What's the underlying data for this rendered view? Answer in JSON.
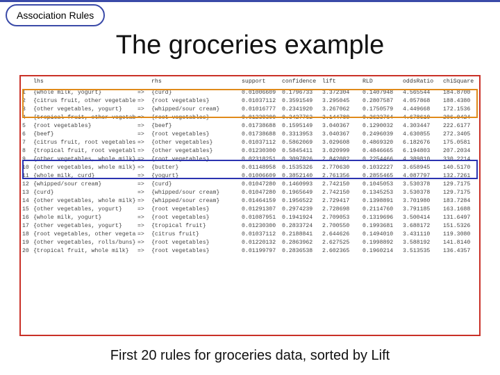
{
  "badge_label": "Association Rules",
  "title": "The groceries example",
  "caption": "First 20 rules for groceries data, sorted by Lift",
  "headers": [
    "",
    "lhs",
    "",
    "rhs",
    "support",
    "confidence",
    "lift",
    "RLD",
    "oddsRatio",
    "chiSquare"
  ],
  "rows": [
    {
      "idx": "1",
      "lhs": "{whole milk,\n yogurt}",
      "rhs": "{curd}",
      "support": "0.01006609",
      "confidence": "0.1796733",
      "lift": "3.372304",
      "rld": "0.1407948",
      "oddsRatio": "4.565544",
      "chiSquare": "184.8700"
    },
    {
      "idx": "2",
      "lhs": "{citrus fruit,\n other vegetables}",
      "rhs": "{root vegetables}",
      "support": "0.01037112",
      "confidence": "0.3591549",
      "lift": "3.295045",
      "rld": "0.2807587",
      "oddsRatio": "4.057868",
      "chiSquare": "188.4380"
    },
    {
      "idx": "3",
      "lhs": "{other vegetables,\n yogurt}",
      "rhs": "{whipped/sour cream}",
      "support": "0.01016777",
      "confidence": "0.2341920",
      "lift": "3.267062",
      "rld": "0.1750579",
      "oddsRatio": "4.449668",
      "chiSquare": "172.1536"
    },
    {
      "idx": "4",
      "lhs": "{tropical fruit,\n other vegetables}",
      "rhs": "{root vegetables}",
      "support": "0.01230300",
      "confidence": "0.3427762",
      "lift": "3.144780",
      "rld": "0.2623764",
      "oddsRatio": "4.678610",
      "chiSquare": "206.0424"
    },
    {
      "idx": "5",
      "lhs": "{root vegetables}",
      "rhs": "{beef}",
      "support": "0.01738688",
      "confidence": "0.1595149",
      "lift": "3.040367",
      "rld": "0.1290032",
      "oddsRatio": "4.303447",
      "chiSquare": "222.6177"
    },
    {
      "idx": "6",
      "lhs": "{beef}",
      "rhs": "{root vegetables}",
      "support": "0.01738688",
      "confidence": "0.3313953",
      "lift": "3.040367",
      "rld": "0.2496039",
      "oddsRatio": "4.630855",
      "chiSquare": "272.3405"
    },
    {
      "idx": "7",
      "lhs": "{citrus fruit,\n root vegetables}",
      "rhs": "{other vegetables}",
      "support": "0.01037112",
      "confidence": "0.5862069",
      "lift": "3.029608",
      "rld": "0.4869320",
      "oddsRatio": "6.182676",
      "chiSquare": "175.0581"
    },
    {
      "idx": "8",
      "lhs": "{tropical fruit,\n root vegetables}",
      "rhs": "{other vegetables}",
      "support": "0.01230300",
      "confidence": "0.5845411",
      "lift": "3.020999",
      "rld": "0.4846665",
      "oddsRatio": "6.194803",
      "chiSquare": "207.2034"
    },
    {
      "idx": "9",
      "lhs": "{other vegetables,\n whole milk}",
      "rhs": "{root vegetables}",
      "support": "0.02318251",
      "confidence": "0.3097826",
      "lift": "2.842082",
      "rld": "0.2254466",
      "oddsRatio": "4.389810",
      "chiSquare": "330.2214"
    },
    {
      "idx": "10",
      "lhs": "{other vegetables,\n whole milk}",
      "rhs": "{butter}",
      "support": "0.01148958",
      "confidence": "0.1535326",
      "lift": "2.770630",
      "rld": "0.1032227",
      "oddsRatio": "3.658945",
      "chiSquare": "140.5170"
    },
    {
      "idx": "11",
      "lhs": "{whole milk,\n curd}",
      "rhs": "{yogurt}",
      "support": "0.01006609",
      "confidence": "0.3852140",
      "lift": "2.761356",
      "rld": "0.2855465",
      "oddsRatio": "4.087797",
      "chiSquare": "132.7261"
    },
    {
      "idx": "12",
      "lhs": "{whipped/sour cream}",
      "rhs": "{curd}",
      "support": "0.01047280",
      "confidence": "0.1460993",
      "lift": "2.742150",
      "rld": "0.1045053",
      "oddsRatio": "3.530378",
      "chiSquare": "129.7175"
    },
    {
      "idx": "13",
      "lhs": "{curd}",
      "rhs": "{whipped/sour cream}",
      "support": "0.01047280",
      "confidence": "0.1965649",
      "lift": "2.742150",
      "rld": "0.1345253",
      "oddsRatio": "3.530378",
      "chiSquare": "129.7175"
    },
    {
      "idx": "14",
      "lhs": "{other vegetables,\n whole milk}",
      "rhs": "{whipped/sour cream}",
      "support": "0.01464159",
      "confidence": "0.1956522",
      "lift": "2.729417",
      "rld": "0.1398891",
      "oddsRatio": "3.701980",
      "chiSquare": "183.7284"
    },
    {
      "idx": "15",
      "lhs": "{other vegetables,\n yogurt}",
      "rhs": "{root vegetables}",
      "support": "0.01291307",
      "confidence": "0.2974239",
      "lift": "2.728698",
      "rld": "0.2114760",
      "oddsRatio": "3.791185",
      "chiSquare": "163.1688"
    },
    {
      "idx": "16",
      "lhs": "{whole milk,\n yogurt}",
      "rhs": "{root vegetables}",
      "support": "0.01087951",
      "confidence": "0.1941924",
      "lift": "2.709053",
      "rld": "0.1319696",
      "oddsRatio": "3.500414",
      "chiSquare": "131.6497"
    },
    {
      "idx": "17",
      "lhs": "{other vegetables,\n yogurt}",
      "rhs": "{tropical fruit}",
      "support": "0.01230300",
      "confidence": "0.2833724",
      "lift": "2.700550",
      "rld": "0.1993681",
      "oddsRatio": "3.688172",
      "chiSquare": "151.5326"
    },
    {
      "idx": "18",
      "lhs": "{root vegetables,\n other vegetables}",
      "rhs": "{citrus fruit}",
      "support": "0.01037112",
      "confidence": "0.2188841",
      "lift": "2.644626",
      "rld": "0.1494010",
      "oddsRatio": "3.431110",
      "chiSquare": "119.3080"
    },
    {
      "idx": "19",
      "lhs": "{other vegetables,\n rolls/buns}",
      "rhs": "{root vegetables}",
      "support": "0.01220132",
      "confidence": "0.2863962",
      "lift": "2.627525",
      "rld": "0.1998892",
      "oddsRatio": "3.588192",
      "chiSquare": "141.8140"
    },
    {
      "idx": "20",
      "lhs": "{tropical fruit,\n whole milk}",
      "rhs": "{root vegetables}",
      "support": "0.01199797",
      "confidence": "0.2836538",
      "lift": "2.602365",
      "rld": "0.1960214",
      "oddsRatio": "3.513535",
      "chiSquare": "136.4357"
    }
  ]
}
